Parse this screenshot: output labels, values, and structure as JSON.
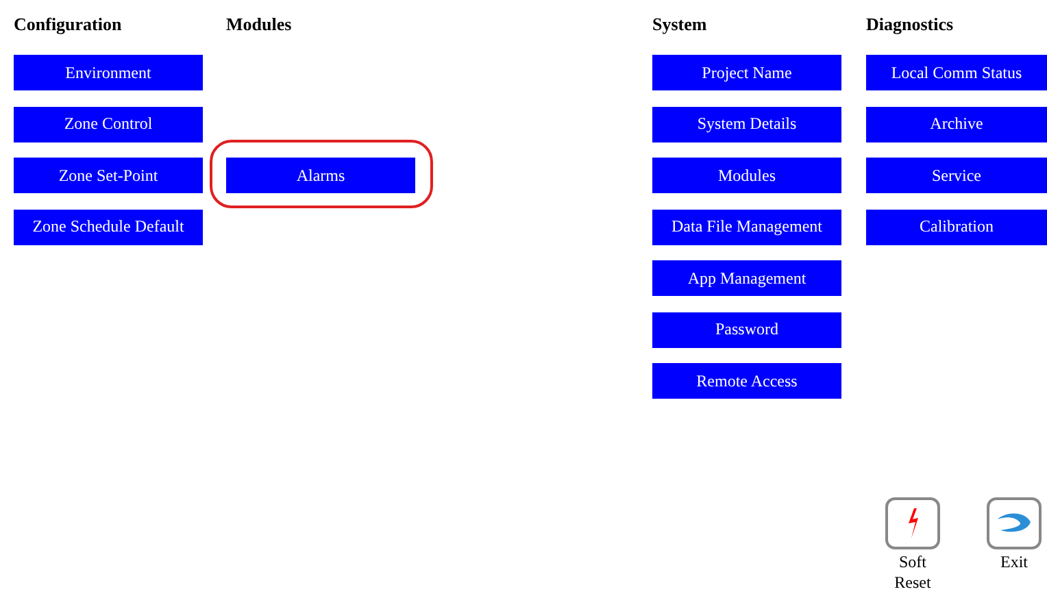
{
  "sections": [
    {
      "title": "Configuration",
      "buttons": [
        {
          "label": "Environment",
          "highlighted": false
        },
        {
          "label": "Zone Control",
          "highlighted": false
        },
        {
          "label": "Zone Set-Point",
          "highlighted": false
        },
        {
          "label": "Zone Schedule Default",
          "highlighted": false
        }
      ]
    },
    {
      "title": "Modules",
      "buttons": [
        {
          "label": "Alarms",
          "highlighted": true
        }
      ]
    },
    {
      "title": "System",
      "buttons": [
        {
          "label": "Project Name",
          "highlighted": false
        },
        {
          "label": "System Details",
          "highlighted": false
        },
        {
          "label": "Modules",
          "highlighted": false
        },
        {
          "label": "Data File Management",
          "highlighted": false
        },
        {
          "label": "App Management",
          "highlighted": false
        },
        {
          "label": "Password",
          "highlighted": false
        },
        {
          "label": "Remote Access",
          "highlighted": false
        }
      ]
    },
    {
      "title": "Diagnostics",
      "buttons": [
        {
          "label": "Local Comm Status",
          "highlighted": false
        },
        {
          "label": "Archive",
          "highlighted": false
        },
        {
          "label": "Service",
          "highlighted": false
        },
        {
          "label": "Calibration",
          "highlighted": false
        }
      ]
    }
  ],
  "actions": [
    {
      "kind": "reset",
      "label_lines": [
        "Soft",
        "Reset"
      ]
    },
    {
      "kind": "exit",
      "label_lines": [
        "Exit"
      ]
    }
  ]
}
